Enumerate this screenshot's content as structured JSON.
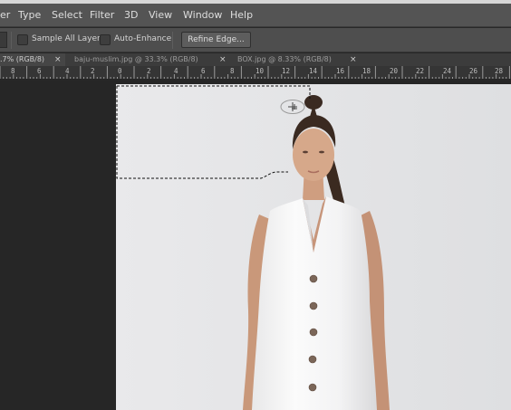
{
  "menu": {
    "items": [
      "er",
      "Type",
      "Select",
      "Filter",
      "3D",
      "View",
      "Window",
      "Help"
    ]
  },
  "options": {
    "sample_all_layers": "Sample All Layers",
    "auto_enhance": "Auto-Enhance",
    "refine_edge": "Refine Edge..."
  },
  "tabs": [
    {
      "label": ".7% (RGB/8)",
      "active": true
    },
    {
      "label": "baju-muslim.jpg @ 33.3% (RGB/8)",
      "active": false
    },
    {
      "label": "BOX.jpg @ 8.33% (RGB/8)",
      "active": false
    }
  ],
  "tab_close_glyph": "×",
  "ruler": {
    "labels": [
      "8",
      "6",
      "4",
      "2",
      "0",
      "2",
      "4",
      "6",
      "8",
      "10",
      "12",
      "14",
      "16",
      "18",
      "20",
      "22",
      "24",
      "26",
      "28"
    ]
  },
  "colors": {
    "menubar": "#545454",
    "options_bar": "#4e4e4e",
    "workspace": "#262626",
    "canvas_background": "#e6e6e8",
    "selection": "#000000"
  },
  "icons": {
    "brush_cursor": "quick-selection-brush-cursor-icon"
  }
}
